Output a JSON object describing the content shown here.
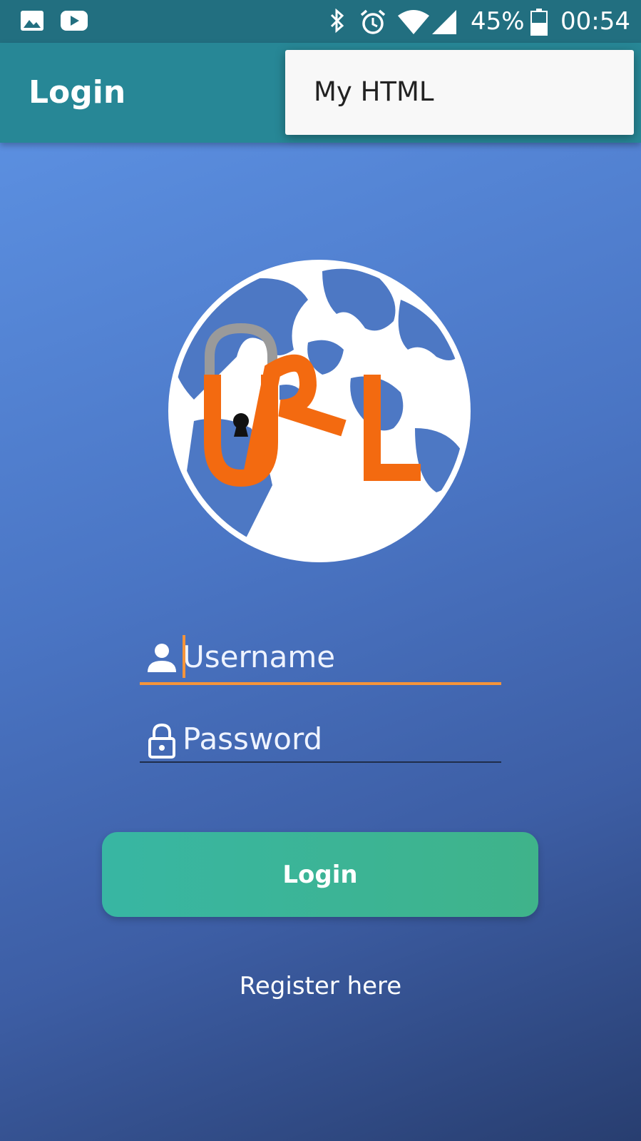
{
  "status_bar": {
    "battery_percent": "45%",
    "time": "00:54",
    "icons": [
      "image-icon",
      "youtube-icon",
      "bluetooth-icon",
      "alarm-icon",
      "wifi-icon",
      "signal-icon",
      "battery-icon"
    ]
  },
  "app_bar": {
    "title": "Login"
  },
  "overflow_menu": {
    "items": [
      {
        "label": "My HTML"
      }
    ]
  },
  "logo": {
    "letters": "URL",
    "icon": "globe-lock-icon"
  },
  "form": {
    "username_placeholder": "Username",
    "password_placeholder": "Password",
    "login_label": "Login",
    "register_label": "Register here"
  },
  "colors": {
    "status_bar": "#226f80",
    "app_bar": "#278796",
    "accent_orange": "#f5943a",
    "button_green": "#3bb59a",
    "gradient_top": "#5b8fe0",
    "gradient_bottom": "#283e70"
  }
}
